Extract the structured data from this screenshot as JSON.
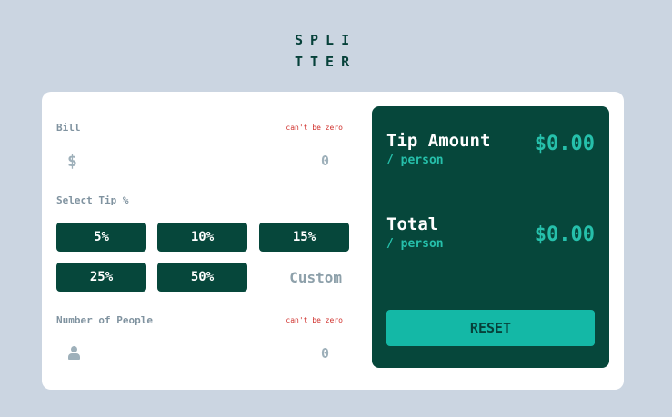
{
  "logo": {
    "line1": "SPLI",
    "line2": "TTER"
  },
  "bill": {
    "label": "Bill",
    "error": "can't be zero",
    "icon": "dollar-icon",
    "icon_glyph": "$",
    "value": "0"
  },
  "tip": {
    "label": "Select Tip %",
    "options": [
      "5%",
      "10%",
      "15%",
      "25%",
      "50%"
    ],
    "custom_placeholder": "Custom"
  },
  "people": {
    "label": "Number of People",
    "error": "can't be zero",
    "icon": "person-icon",
    "value": "0"
  },
  "results": {
    "tip_title": "Tip Amount",
    "tip_sub": "/ person",
    "tip_amount": "$0.00",
    "total_title": "Total",
    "total_sub": "/ person",
    "total_amount": "$0.00",
    "reset_label": "RESET"
  },
  "colors": {
    "background": "#cbd5e1",
    "panel": "#06473b",
    "accent": "#26c0ab",
    "reset": "#14b8a6",
    "error": "#d0312d"
  }
}
